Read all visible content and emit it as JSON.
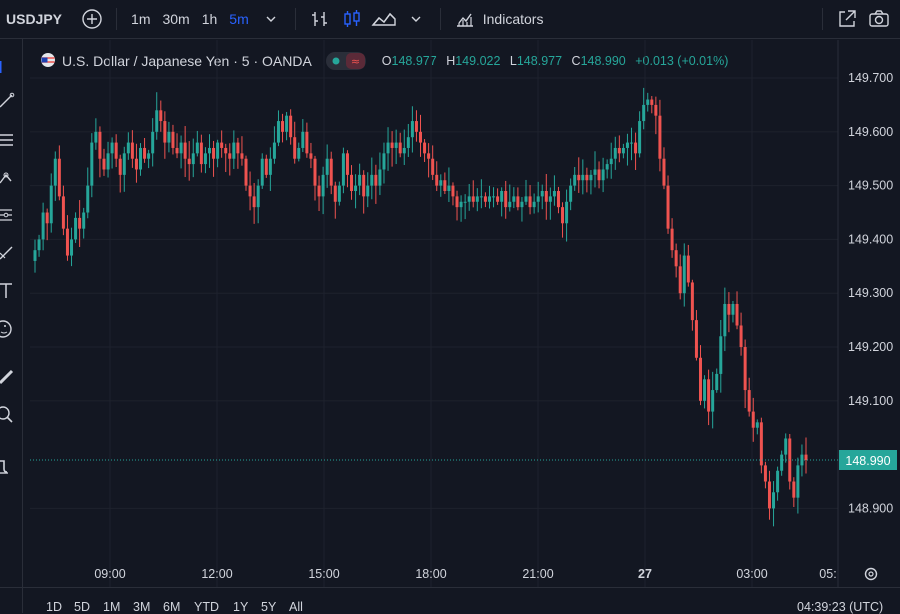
{
  "toolbar": {
    "symbol": "USDJPY",
    "timeframes": [
      "1m",
      "30m",
      "1h",
      "5m"
    ],
    "active_timeframe": "5m",
    "indicators_label": "Indicators"
  },
  "legend": {
    "title": "U.S. Dollar / Japanese Yen · 5 · OANDA",
    "o_label": "O",
    "o": "148.977",
    "h_label": "H",
    "h": "149.022",
    "l_label": "L",
    "l": "148.977",
    "c_label": "C",
    "c": "148.990",
    "change": "+0.013 (+0.01%)"
  },
  "price_label": "148.990",
  "range_buttons": [
    "1D",
    "5D",
    "1M",
    "3M",
    "6M",
    "YTD",
    "1Y",
    "5Y",
    "All"
  ],
  "clock": "04:39:23 (UTC)",
  "colors": {
    "up": "#26a69a",
    "down": "#ef5350",
    "background": "#131722",
    "accent": "#2962ff"
  },
  "icons": [
    "plus-icon",
    "bar-style-icon",
    "candles-icon",
    "area-icon",
    "chevron-down-icon",
    "indicators-icon",
    "snapshot-icon",
    "camera-icon",
    "crosshair-icon",
    "trendline-icon",
    "fib-icon",
    "brush-icon",
    "pattern-icon",
    "pencil-icon",
    "text-icon",
    "emoji-icon",
    "ruler-icon",
    "zoom-icon",
    "magnet-icon",
    "settings-icon"
  ],
  "chart_data": {
    "type": "candlestick",
    "yticks": [
      "149.700",
      "149.600",
      "149.500",
      "149.400",
      "149.300",
      "149.200",
      "149.100",
      "148.900"
    ],
    "ylim": [
      148.83,
      149.74
    ],
    "xticks": [
      "09:00",
      "12:00",
      "15:00",
      "18:00",
      "21:00",
      "27",
      "03:00",
      "05:"
    ],
    "last_price": 148.99,
    "series_close": [
      149.38,
      149.4,
      149.45,
      149.43,
      149.5,
      149.55,
      149.48,
      149.42,
      149.37,
      149.4,
      149.44,
      149.42,
      149.45,
      149.5,
      149.58,
      149.6,
      149.55,
      149.53,
      149.56,
      149.58,
      149.55,
      149.52,
      149.56,
      149.58,
      149.55,
      149.53,
      149.57,
      149.55,
      149.56,
      149.6,
      149.64,
      149.62,
      149.58,
      149.6,
      149.57,
      149.56,
      149.58,
      149.55,
      149.54,
      149.56,
      149.58,
      149.54,
      149.56,
      149.57,
      149.55,
      149.58,
      149.57,
      149.56,
      149.55,
      149.58,
      149.56,
      149.55,
      149.5,
      149.48,
      149.46,
      149.5,
      149.55,
      149.52,
      149.55,
      149.58,
      149.62,
      149.6,
      149.63,
      149.59,
      149.55,
      149.57,
      149.6,
      149.56,
      149.55,
      149.5,
      149.48,
      149.52,
      149.55,
      149.5,
      149.47,
      149.5,
      149.56,
      149.52,
      149.49,
      149.5,
      149.52,
      149.48,
      149.5,
      149.52,
      149.5,
      149.53,
      149.56,
      149.58,
      149.57,
      149.58,
      149.56,
      149.57,
      149.59,
      149.62,
      149.6,
      149.58,
      149.56,
      149.55,
      149.52,
      149.5,
      149.51,
      149.49,
      149.5,
      149.48,
      149.46,
      149.47,
      149.47,
      149.48,
      149.47,
      149.48,
      149.48,
      149.47,
      149.48,
      149.48,
      149.47,
      149.49,
      149.46,
      149.47,
      149.48,
      149.46,
      149.47,
      149.48,
      149.46,
      149.47,
      149.48,
      149.49,
      149.47,
      149.48,
      149.49,
      149.46,
      149.43,
      149.47,
      149.5,
      149.52,
      149.51,
      149.52,
      149.51,
      149.52,
      149.53,
      149.51,
      149.53,
      149.54,
      149.55,
      149.57,
      149.56,
      149.57,
      149.58,
      149.58,
      149.56,
      149.62,
      149.65,
      149.66,
      149.65,
      149.63,
      149.55,
      149.5,
      149.42,
      149.38,
      149.35,
      149.3,
      149.37,
      149.32,
      149.25,
      149.18,
      149.1,
      149.14,
      149.08,
      149.12,
      149.15,
      149.22,
      149.28,
      149.26,
      149.28,
      149.24,
      149.2,
      149.12,
      149.08,
      149.05,
      149.06,
      148.98,
      148.95,
      148.9,
      148.93,
      148.97,
      149.0,
      149.03,
      148.95,
      148.92,
      148.98,
      149.0,
      148.99
    ],
    "price_axis_label": "148.990"
  }
}
